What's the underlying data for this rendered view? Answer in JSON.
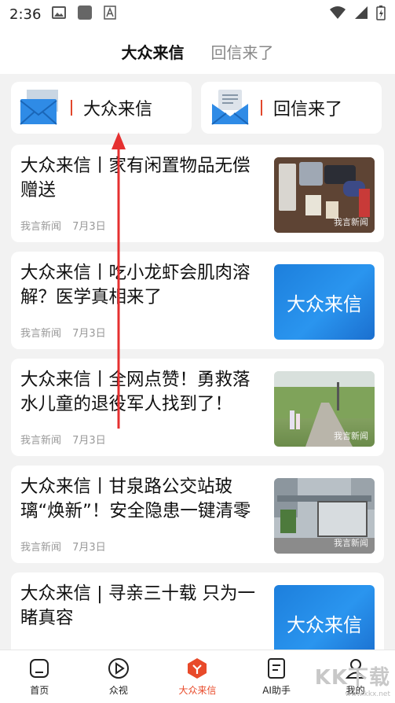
{
  "status_bar": {
    "time": "2:36"
  },
  "top_tabs": [
    {
      "label": "大众来信",
      "active": true
    },
    {
      "label": "回信来了",
      "active": false
    }
  ],
  "category_cards": [
    {
      "label": "大众来信",
      "icon": "mail-envelope-icon"
    },
    {
      "label": "回信来了",
      "icon": "letter-reply-icon"
    }
  ],
  "articles": [
    {
      "title": "大众来信丨家有闲置物品无偿赠送",
      "source": "我言新闻",
      "date": "7月3日",
      "thumb": "photo-items"
    },
    {
      "title": "大众来信丨吃小龙虾会肌肉溶解？医学真相来了",
      "source": "我言新闻",
      "date": "7月3日",
      "thumb": "blue-card",
      "thumb_text": "大众来信"
    },
    {
      "title": "大众来信丨全网点赞！勇救落水儿童的退役军人找到了！",
      "source": "我言新闻",
      "date": "7月3日",
      "thumb": "photo-park"
    },
    {
      "title": "大众来信丨甘泉路公交站玻璃“焕新”！安全隐患一键清零",
      "source": "我言新闻",
      "date": "7月3日",
      "thumb": "photo-busstop"
    },
    {
      "title": "大众来信 | 寻亲三十载 只为一睹真容",
      "source": "",
      "date": "",
      "thumb": "blue-card",
      "thumb_text": "大众来信"
    }
  ],
  "bottom_nav": [
    {
      "label": "首页",
      "icon": "home-icon",
      "active": false
    },
    {
      "label": "众视",
      "icon": "play-icon",
      "active": false
    },
    {
      "label": "大众来信",
      "icon": "mail-brand-icon",
      "active": true
    },
    {
      "label": "AI助手",
      "icon": "document-icon",
      "active": false
    },
    {
      "label": "我的",
      "icon": "profile-icon",
      "active": false
    }
  ],
  "colors": {
    "accent": "#e84a2a",
    "blue": "#1d7fdc"
  }
}
